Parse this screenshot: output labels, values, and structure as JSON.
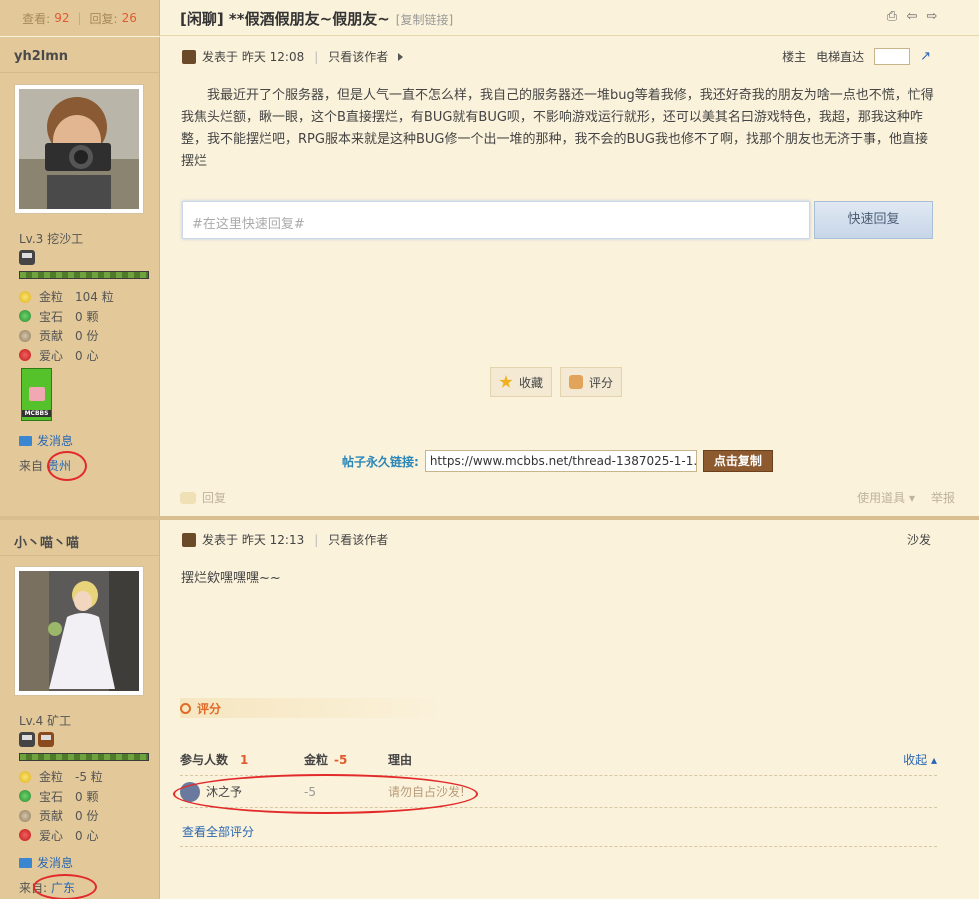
{
  "header": {
    "views_label": "查看:",
    "views": "92",
    "replies_label": "回复:",
    "replies": "26",
    "title": "[闲聊] **假酒假朋友~假朋友~",
    "copy_link": "[复制链接]",
    "icons": [
      "print-icon",
      "prev-thread-icon",
      "next-thread-icon"
    ]
  },
  "posts": [
    {
      "author": "yh2lmn",
      "level": "Lv.3 挖沙工",
      "stats": {
        "gold": {
          "label": "金粒",
          "value": "104 粒"
        },
        "gem": {
          "label": "宝石",
          "value": "0 颗"
        },
        "contrib": {
          "label": "贡献",
          "value": "0 份"
        },
        "love": {
          "label": "爱心",
          "value": "0 心"
        }
      },
      "medal_text": "MCBBS",
      "pm": "发消息",
      "from_label": "来自",
      "from_place": "贵州",
      "posted": "发表于 昨天 12:08",
      "only_author": "只看该作者",
      "floor": "楼主",
      "elevator": "电梯直达",
      "body": "我最近开了个服务器，但是人气一直不怎么样，我自己的服务器还一堆bug等着我修，我还好奇我的朋友为啥一点也不慌，忙得我焦头烂额，瞅一眼，这个B直接摆烂，有BUG就有BUG呗，不影响游戏运行就形，还可以美其名曰游戏特色，我超，那我这种咋整，我不能摆烂吧，RPG服本来就是这种BUG修一个出一堆的那种，我不会的BUG我也修不了啊，找那个朋友也无济于事，他直接摆烂",
      "reply_placeholder": "#在这里快速回复#",
      "reply_button": "快速回复",
      "favorite": "收藏",
      "rate": "评分",
      "permalink_label": "帖子永久链接:",
      "permalink": "https://www.mcbbs.net/thread-1387025-1-1.html",
      "copy_button": "点击复制",
      "reply_link": "回复",
      "tools": "使用道具",
      "report": "举报"
    },
    {
      "author": "小丶喵丶喵",
      "level": "Lv.4 矿工",
      "stats": {
        "gold": {
          "label": "金粒",
          "value": "-5 粒"
        },
        "gem": {
          "label": "宝石",
          "value": "0 颗"
        },
        "contrib": {
          "label": "贡献",
          "value": "0 份"
        },
        "love": {
          "label": "爱心",
          "value": "0 心"
        }
      },
      "pm": "发消息",
      "from_label": "来自:",
      "from_place": "广东",
      "posted": "发表于 昨天 12:13",
      "only_author": "只看该作者",
      "floor": "沙发",
      "body": "摆烂欸嘿嘿嘿~~",
      "rating": {
        "title": "评分",
        "participants_label": "参与人数",
        "participants": "1",
        "gold_label": "金粒",
        "gold_total": "-5",
        "reason_label": "理由",
        "collapse": "收起",
        "rows": [
          {
            "user": "沐之予",
            "gold": "-5",
            "reason": "请勿自占沙发!"
          }
        ],
        "view_all": "查看全部评分"
      }
    }
  ]
}
